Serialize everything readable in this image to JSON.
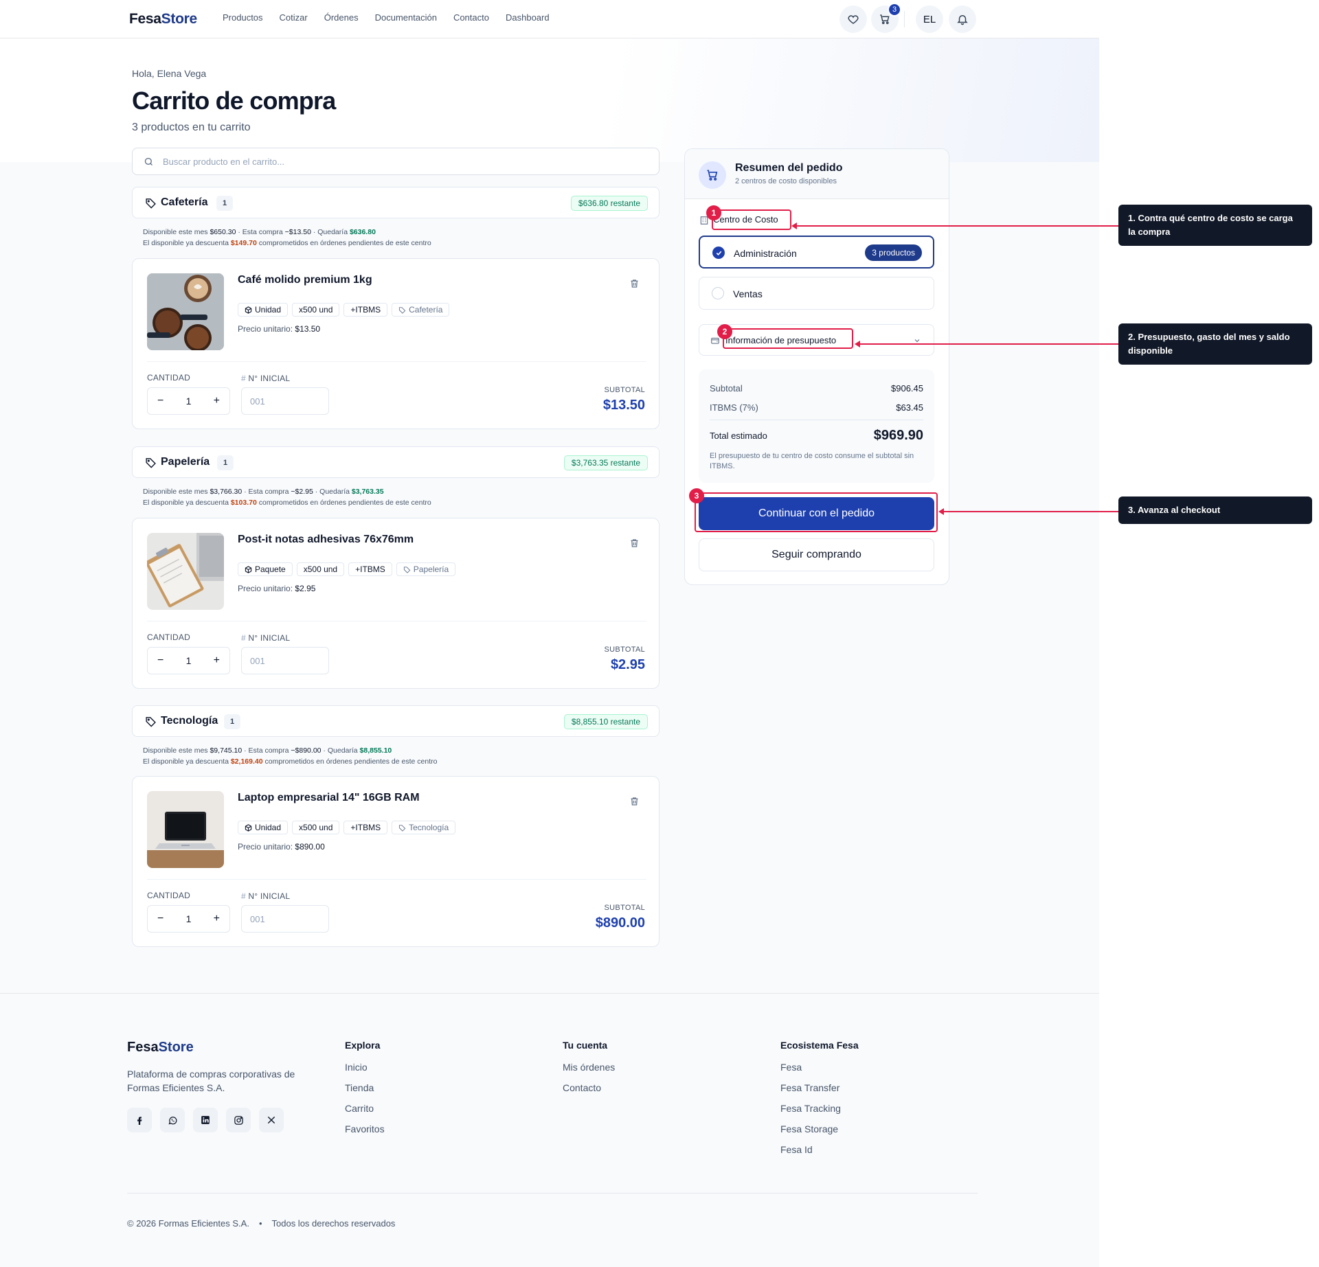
{
  "brand": {
    "name_a": "Fesa",
    "name_b": "Store"
  },
  "nav": [
    "Productos",
    "Cotizar",
    "Órdenes",
    "Documentación",
    "Contacto",
    "Dashboard"
  ],
  "header": {
    "cart_count": "3",
    "avatar": "EL"
  },
  "page": {
    "greeting": "Hola, Elena Vega",
    "title": "Carrito de compra",
    "subtitle": "3 productos en tu carrito",
    "search_placeholder": "Buscar producto en el carrito..."
  },
  "labels": {
    "available": "Disponible este mes",
    "this_purchase": "Esta compra",
    "would_remain": "Quedaría",
    "discount_prefix": "El disponible ya descuenta",
    "discount_suffix": "comprometidos en órdenes pendientes de este centro",
    "unit_price": "Precio unitario:",
    "quantity": "CANTIDAD",
    "initial_no": "N° INICIAL",
    "subtotal": "SUBTOTAL",
    "initial_placeholder": "001"
  },
  "categories": [
    {
      "name": "Cafetería",
      "count": "1",
      "remaining": "$636.80 restante",
      "available": "$650.30",
      "this_purchase": "−$13.50",
      "would_remain": "$636.80",
      "committed": "$149.70",
      "product": {
        "name": "Café molido premium 1kg",
        "unit": "Unidad",
        "pack": "x500 und",
        "tax": "+ITBMS",
        "tag": "Cafetería",
        "price": "$13.50",
        "qty": "1",
        "subtotal": "$13.50"
      }
    },
    {
      "name": "Papelería",
      "count": "1",
      "remaining": "$3,763.35 restante",
      "available": "$3,766.30",
      "this_purchase": "−$2.95",
      "would_remain": "$3,763.35",
      "committed": "$103.70",
      "product": {
        "name": "Post-it notas adhesivas 76x76mm",
        "unit": "Paquete",
        "pack": "x500 und",
        "tax": "+ITBMS",
        "tag": "Papelería",
        "price": "$2.95",
        "qty": "1",
        "subtotal": "$2.95"
      }
    },
    {
      "name": "Tecnología",
      "count": "1",
      "remaining": "$8,855.10 restante",
      "available": "$9,745.10",
      "this_purchase": "−$890.00",
      "would_remain": "$8,855.10",
      "committed": "$2,169.40",
      "product": {
        "name": "Laptop empresarial 14\" 16GB RAM",
        "unit": "Unidad",
        "pack": "x500 und",
        "tax": "+ITBMS",
        "tag": "Tecnología",
        "price": "$890.00",
        "qty": "1",
        "subtotal": "$890.00"
      }
    }
  ],
  "summary": {
    "title": "Resumen del pedido",
    "subtitle": "2 centros de costo disponibles",
    "cost_center_label": "Centro de Costo",
    "options": [
      {
        "label": "Administración",
        "badge": "3 productos",
        "selected": true
      },
      {
        "label": "Ventas",
        "selected": false
      }
    ],
    "budget_label": "Información de presupuesto",
    "subtotal_label": "Subtotal",
    "subtotal": "$906.45",
    "tax_label": "ITBMS (7%)",
    "tax": "$63.45",
    "total_label": "Total estimado",
    "total": "$969.90",
    "note": "El presupuesto de tu centro de costo consume el subtotal sin ITBMS.",
    "continue_label": "Continuar con el pedido",
    "keep_shopping_label": "Seguir comprando"
  },
  "annotations": [
    {
      "num": "1",
      "text": "1. Contra qué centro de costo se carga la compra"
    },
    {
      "num": "2",
      "text": "2. Presupuesto, gasto del mes y saldo disponible"
    },
    {
      "num": "3",
      "text": "3. Avanza al checkout"
    }
  ],
  "footer": {
    "description": "Plataforma de compras corporativas de Formas Eficientes S.A.",
    "col1_title": "Explora",
    "col1": [
      "Inicio",
      "Tienda",
      "Carrito",
      "Favoritos"
    ],
    "col2_title": "Tu cuenta",
    "col2": [
      "Mis órdenes",
      "Contacto"
    ],
    "col3_title": "Ecosistema Fesa",
    "col3": [
      "Fesa",
      "Fesa Transfer",
      "Fesa Tracking",
      "Fesa Storage",
      "Fesa Id"
    ],
    "copyright": "© 2026 Formas Eficientes S.A.",
    "rights": "Todos los derechos reservados"
  },
  "colors": {
    "brand": "#1e3a8a",
    "primary": "#1e40af",
    "success": "#047857",
    "warning": "#c2410c",
    "annotation": "#e11d48"
  }
}
